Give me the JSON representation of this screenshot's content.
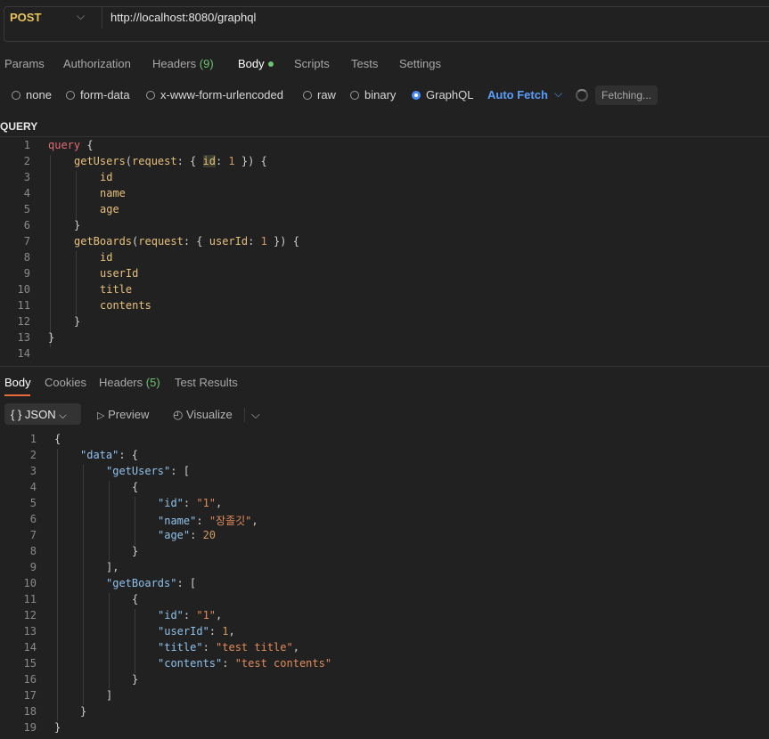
{
  "request": {
    "method": "POST",
    "url": "http://localhost:8080/graphql"
  },
  "tabs": {
    "params": "Params",
    "authorization": "Authorization",
    "headers": "Headers",
    "headers_count": "(9)",
    "body": "Body",
    "scripts": "Scripts",
    "tests": "Tests",
    "settings": "Settings"
  },
  "body_types": {
    "none": "none",
    "form_data": "form-data",
    "urlencoded": "x-www-form-urlencoded",
    "raw": "raw",
    "binary": "binary",
    "graphql": "GraphQL",
    "selected": "GraphQL"
  },
  "auto_fetch": "Auto Fetch",
  "fetching": "Fetching...",
  "query_label": "QUERY",
  "query": {
    "line_numbers": [
      "1",
      "2",
      "3",
      "4",
      "5",
      "6",
      "7",
      "8",
      "9",
      "10",
      "11",
      "12",
      "13",
      "14"
    ],
    "keyword": "query",
    "op1": "getUsers",
    "op1_arg_name": "request",
    "op1_arg_field": "id",
    "op1_arg_value": "1",
    "op1_fields": [
      "id",
      "name",
      "age"
    ],
    "op2": "getBoards",
    "op2_arg_name": "request",
    "op2_arg_field": "userId",
    "op2_arg_value": "1",
    "op2_fields": [
      "id",
      "userId",
      "title",
      "contents"
    ]
  },
  "response_tabs": {
    "body": "Body",
    "cookies": "Cookies",
    "headers": "Headers",
    "headers_count": "(5)",
    "test_results": "Test Results"
  },
  "response_toolbar": {
    "format": "JSON",
    "preview": "Preview",
    "visualize": "Visualize"
  },
  "response": {
    "line_numbers": [
      "1",
      "2",
      "3",
      "4",
      "5",
      "6",
      "7",
      "8",
      "9",
      "10",
      "11",
      "12",
      "13",
      "14",
      "15",
      "16",
      "17",
      "18",
      "19"
    ],
    "k_data": "\"data\"",
    "k_getUsers": "\"getUsers\"",
    "k_id": "\"id\"",
    "k_name": "\"name\"",
    "k_age": "\"age\"",
    "k_getBoards": "\"getBoards\"",
    "k_userId": "\"userId\"",
    "k_title": "\"title\"",
    "k_contents": "\"contents\"",
    "user_id": "\"1\"",
    "user_name": "\"장졸깃\"",
    "user_age": "20",
    "board_id": "\"1\"",
    "board_userId": "1",
    "board_title": "\"test title\"",
    "board_contents": "\"test contents\""
  }
}
